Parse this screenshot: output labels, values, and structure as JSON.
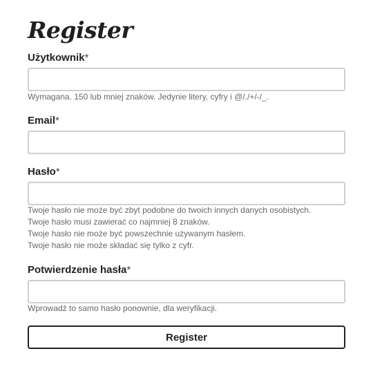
{
  "title": "Register",
  "fields": {
    "username": {
      "label": "Użytkownik",
      "required_mark": "*",
      "value": "",
      "help": [
        "Wymagana. 150 lub mniej znaków. Jedynie litery, cyfry i @/./+/-/_."
      ]
    },
    "email": {
      "label": "Email",
      "required_mark": "*",
      "value": ""
    },
    "password": {
      "label": "Hasło",
      "required_mark": "*",
      "value": "",
      "help": [
        "Twoje hasło nie może być zbyt podobne do twoich innych danych osobistych.",
        "Twoje hasło musi zawierać co najmniej 8 znaków.",
        "Twoje hasło nie może być powszechnie używanym hasłem.",
        "Twoje hasło nie może składać się tylko z cyfr."
      ]
    },
    "password_confirm": {
      "label": "Potwierdzenie hasła",
      "required_mark": "*",
      "value": "",
      "help": [
        "Wprowadź to samo hasło ponownie, dla weryfikacji."
      ]
    }
  },
  "submit_label": "Register"
}
